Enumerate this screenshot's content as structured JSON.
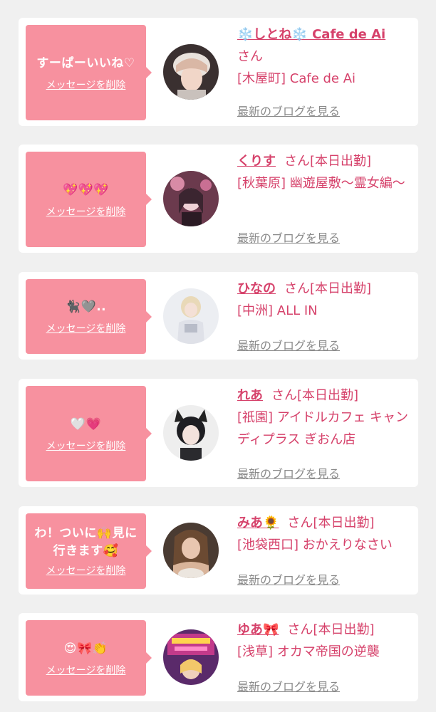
{
  "delete_label": "メッセージを削除",
  "blog_label": "最新のブログを見る",
  "colors": {
    "bubble": "#f7919f",
    "name": "#d6426b",
    "card": "#ffffff",
    "background": "#f0f0f0"
  },
  "items": [
    {
      "message": "すーぱーいいね♡",
      "name": "❄️しとね❄️ Cafe de Ai",
      "suffix": "さん",
      "shop": "[木屋町] Cafe de Ai"
    },
    {
      "message": "💖💖💖",
      "name": "くりす",
      "suffix": "さん[本日出勤]",
      "shop": "[秋葉原] 幽遊屋敷〜霊女編〜"
    },
    {
      "message": "🐈‍⬛🩶..",
      "name": "ひなの",
      "suffix": "さん[本日出勤]",
      "shop": "[中洲] ALL IN"
    },
    {
      "message": "🤍💗",
      "name": "れあ",
      "suffix": "さん[本日出勤]",
      "shop": "[祇園] アイドルカフェ キャンディプラス ぎおん店"
    },
    {
      "message": "わ！ついに🙌見に行きます🥰",
      "name": "みあ🌻",
      "suffix": "さん[本日出勤]",
      "shop": "[池袋西口] おかえりなさい"
    },
    {
      "message": "😍🎀👏",
      "name": "ゆあ🎀",
      "suffix": "さん[本日出勤]",
      "shop": "[浅草] オカマ帝国の逆襲"
    }
  ]
}
